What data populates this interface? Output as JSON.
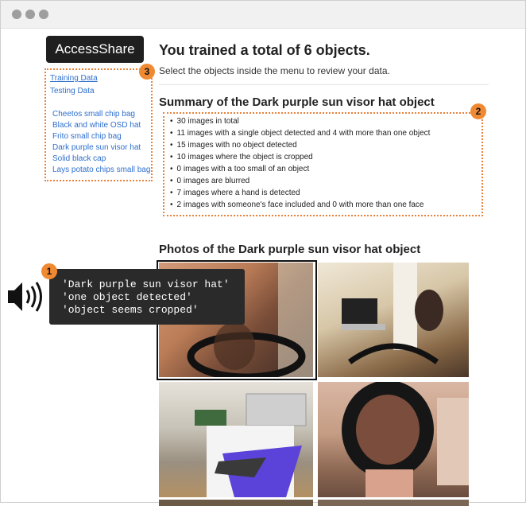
{
  "brand": "AccessShare",
  "sidebar": {
    "nav": [
      "Training Data",
      "Testing Data"
    ],
    "objects": [
      "Cheetos small chip bag",
      "Black and white OSD hat",
      "Frito small chip bag",
      "Dark purple sun visor hat",
      "Solid black cap",
      "Lays potato chips small bag"
    ]
  },
  "main": {
    "title": "You trained a total of 6 objects.",
    "subtitle": "Select the objects inside the menu to review your data.",
    "summary_title": "Summary of the Dark purple sun visor hat object",
    "summary_items": [
      "30 images in total",
      "11 images with a single object detected and 4 with more than one object",
      "15 images with no object detected",
      "10 images where the object is cropped",
      "0 images with a too small of an object",
      "0 images are blurred",
      "7 images where a hand is detected",
      "2 images with someone's face included and 0 with more than one face"
    ],
    "photos_title": "Photos of the Dark purple sun visor hat object"
  },
  "callouts": {
    "one": "1",
    "two": "2",
    "three": "3"
  },
  "tts_lines": [
    "'Dark purple sun visor hat'",
    "'one object detected'",
    "'object seems cropped'"
  ],
  "icons": {
    "speaker": "speaker-icon"
  },
  "colors": {
    "accent": "#e8823a",
    "link": "#2e6fce",
    "tts_bg": "#2a2a2a"
  }
}
